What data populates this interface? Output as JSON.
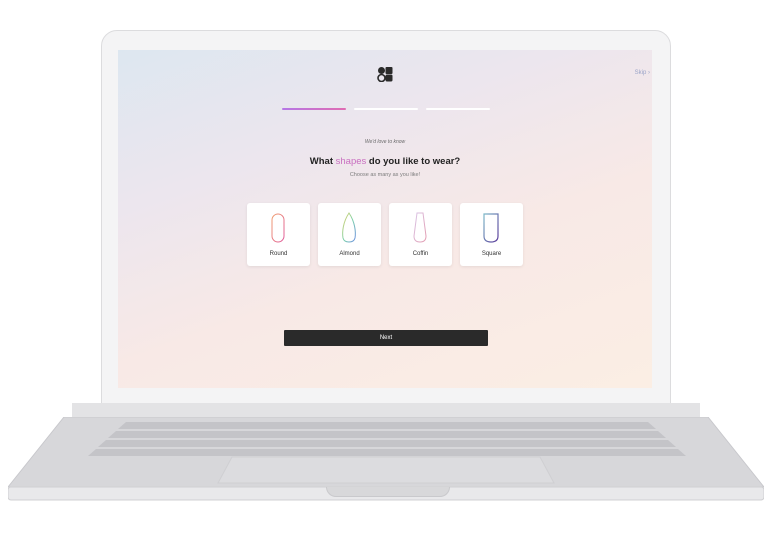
{
  "header": {
    "logo_icon": "flower-logo-icon",
    "skip_label": "Skip ›"
  },
  "progress": {
    "steps_total": 3,
    "current_step": 1,
    "active_gradient": [
      "#b577e6",
      "#e06cb2"
    ]
  },
  "prompt": {
    "eyebrow": "We'd love to know",
    "question_before": "What ",
    "question_highlight": "shapes",
    "question_after": " do you like to wear?",
    "subtitle": "Choose as many as you like!"
  },
  "options": [
    {
      "label": "Round",
      "icon": "round-nail-icon"
    },
    {
      "label": "Almond",
      "icon": "almond-nail-icon"
    },
    {
      "label": "Coffin",
      "icon": "coffin-nail-icon"
    },
    {
      "label": "Square",
      "icon": "square-nail-icon"
    }
  ],
  "actions": {
    "next_label": "Next"
  },
  "colors": {
    "highlight": "#c96fc0",
    "button_bg": "#2a2a2a"
  }
}
